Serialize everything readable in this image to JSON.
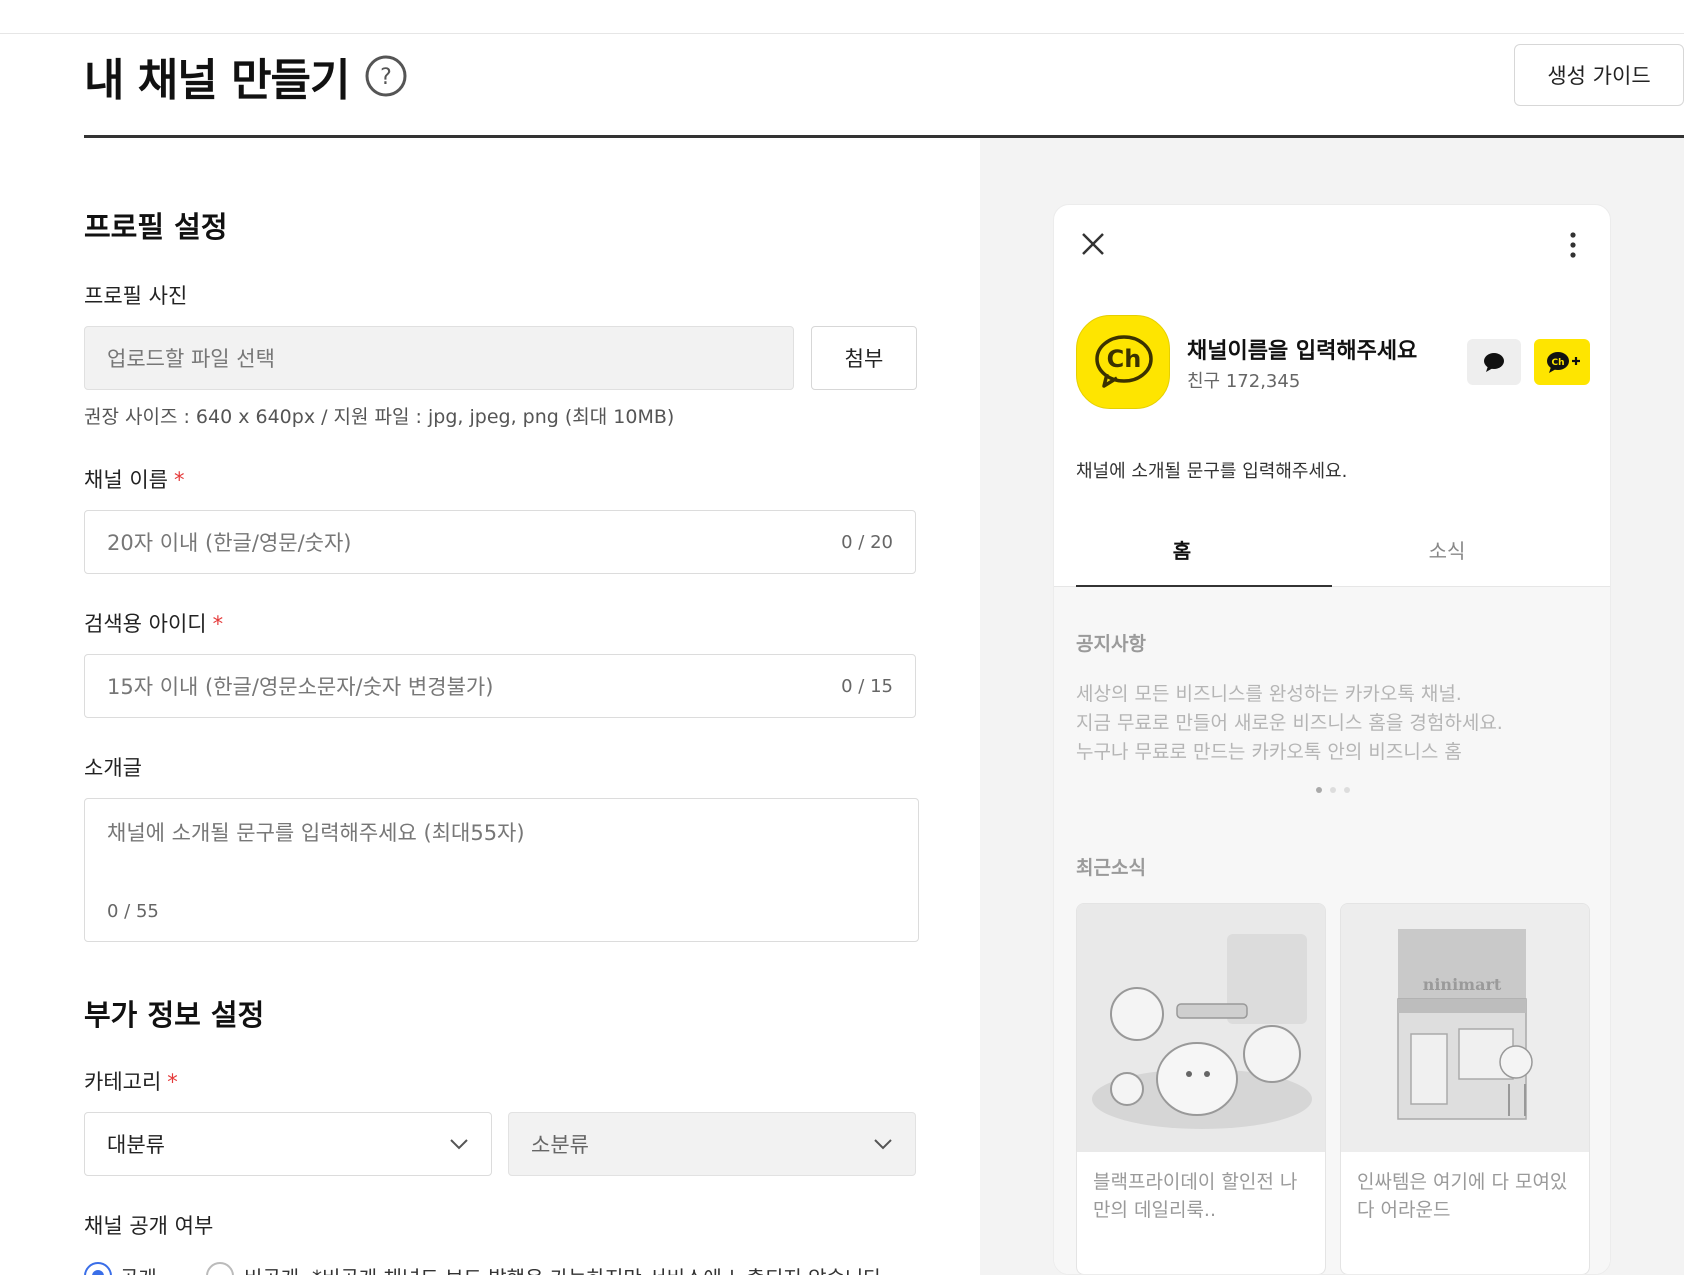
{
  "header": {
    "title": "내 채널 만들기",
    "help_icon": "question-circle-icon",
    "guide_label": "생성 가이드"
  },
  "profile": {
    "section_title": "프로필 설정",
    "photo_label": "프로필 사진",
    "file_placeholder": "업로드할 파일 선택",
    "attach_label": "첨부",
    "photo_hint": "권장 사이즈 : 640 x 640px / 지원 파일 : jpg, jpeg, png (최대 10MB)",
    "name_label": "채널 이름",
    "name_placeholder": "20자 이내 (한글/영문/숫자)",
    "name_count": "0 / 20",
    "search_id_label": "검색용 아이디",
    "search_id_placeholder": "15자 이내 (한글/영문소문자/숫자 변경불가)",
    "search_id_count": "0 / 15",
    "intro_label": "소개글",
    "intro_placeholder": "채널에 소개될 문구를 입력해주세요 (최대55자)",
    "intro_count": "0 / 55",
    "required_mark": "*"
  },
  "extra": {
    "section_title": "부가 정보 설정",
    "category_label": "카테고리",
    "category_major": "대분류",
    "category_minor": "소분류",
    "visibility_label": "채널 공개 여부",
    "public_label": "공개",
    "private_label": "비공개",
    "private_note": "*비공개 채널도 보드 발행은 가능하지만 서비스에 노출되지 않습니다.",
    "selected": "public"
  },
  "preview": {
    "avatar_text": "Ch",
    "channel_name": "채널이름을 입력해주세요",
    "friends": "친구 172,345",
    "intro": "채널에 소개될 문구를 입력해주세요.",
    "tabs": [
      "홈",
      "소식"
    ],
    "active_tab": "홈",
    "notice_title": "공지사항",
    "notice_lines": [
      "세상의 모든 비즈니스를 완성하는 카카오톡 채널.",
      "지금 무료로 만들어 새로운 비즈니스 홈을 경험하세요.",
      "누구나 무료로 만드는 카카오톡 안의 비즈니스 홈"
    ],
    "news_title": "최근소식",
    "news_cards": [
      {
        "text": "블랙프라이데이 할인전 나만의 데일리룩.."
      },
      {
        "text": "인싸템은 여기에 다 모여있다 어라운드",
        "sign": "ninimart"
      }
    ],
    "icons": {
      "close": "close-icon",
      "more": "more-vertical-icon",
      "chat": "chat-bubble-icon",
      "add_friend": "channel-plus-icon"
    }
  },
  "colors": {
    "accent_yellow": "#fee500",
    "required_red": "#e53a3a",
    "radio_blue": "#3a6ee8"
  }
}
